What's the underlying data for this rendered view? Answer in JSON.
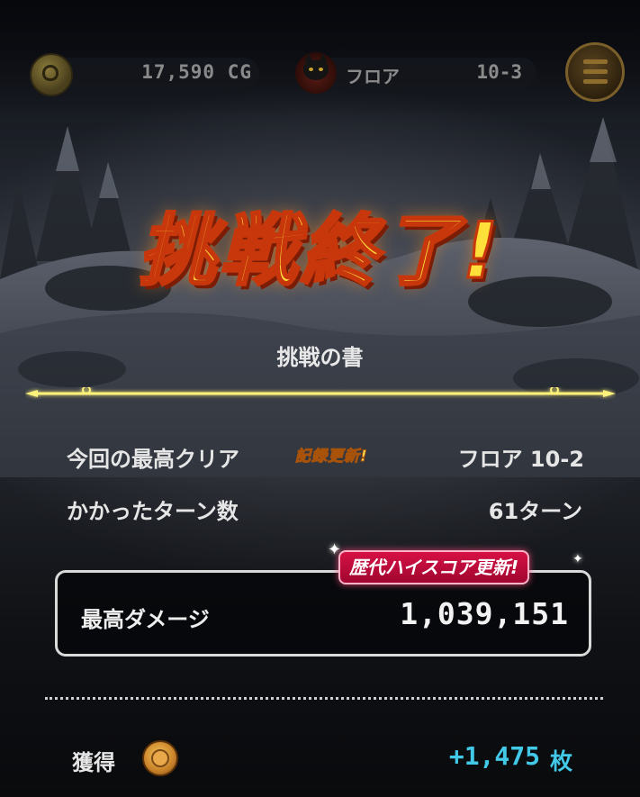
{
  "header": {
    "cg_value": "17,590 CG",
    "floor_label": "フロア",
    "floor_value": "10-3"
  },
  "result": {
    "title": "挑戦終了!",
    "subtitle": "挑戦の書",
    "best_clear_label": "今回の最高クリア",
    "record_badge": "記録更新!",
    "best_clear_value": "フロア 10-2",
    "turns_label": "かかったターン数",
    "turns_value": "61ターン",
    "highscore_badge": "歴代ハイスコア更新!",
    "max_damage_label": "最高ダメージ",
    "max_damage_value": "1,039,151",
    "gain_label": "獲得",
    "gain_value": "+1,475",
    "gain_unit": "枚"
  },
  "colors": {
    "title_fill": "#ffdf3a",
    "title_stroke": "#c8360b",
    "divider_glow": "#fff27a",
    "highscore_badge_bg": "#d61044",
    "gain_value": "#42c9e8"
  },
  "icons": [
    "coin-icon",
    "monster-icon",
    "menu-icon",
    "medal-icon",
    "sparkle-icon"
  ]
}
